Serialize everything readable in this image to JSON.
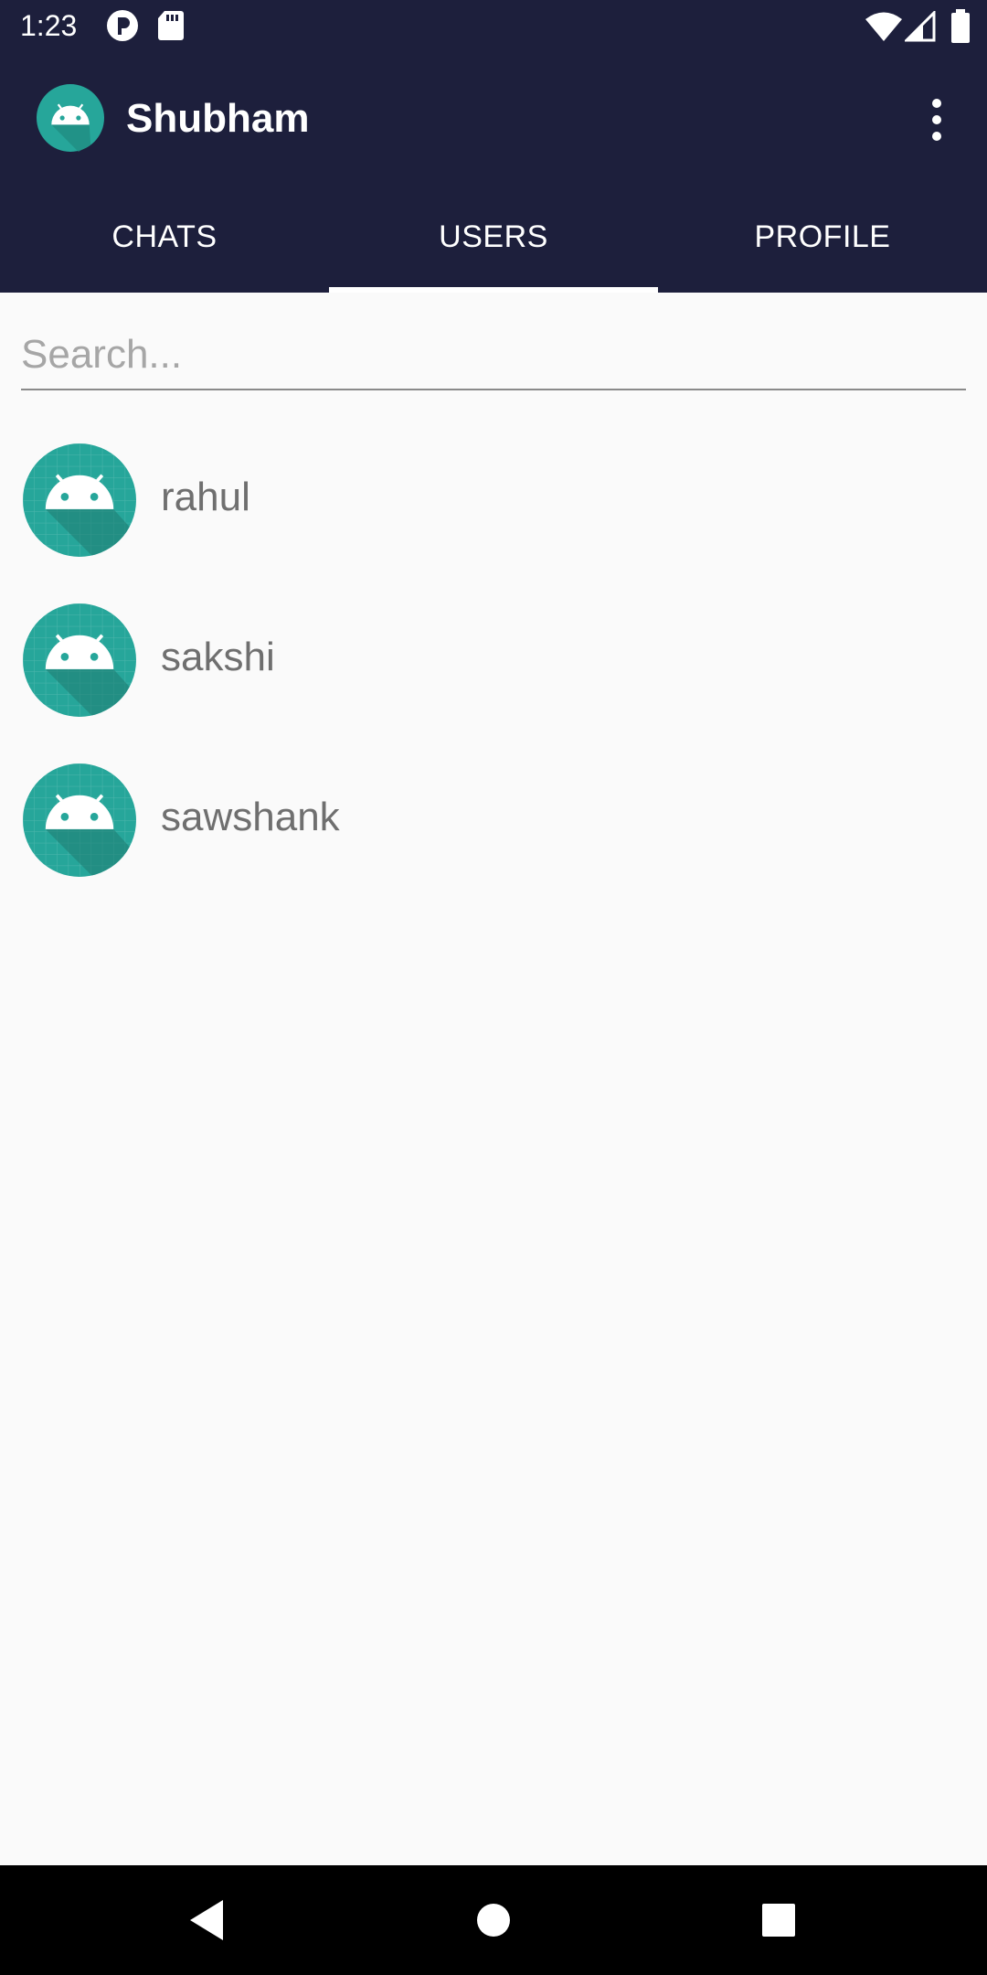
{
  "status_bar": {
    "time": "1:23",
    "icons": [
      "notification-p-icon",
      "sd-card-icon",
      "wifi-icon",
      "signal-icon",
      "battery-icon"
    ]
  },
  "toolbar": {
    "title": "Shubham",
    "menu_icon": "more-vert-icon"
  },
  "tabs": [
    {
      "label": "CHATS",
      "selected": false
    },
    {
      "label": "USERS",
      "selected": true
    },
    {
      "label": "PROFILE",
      "selected": false
    }
  ],
  "search": {
    "placeholder": "Search...",
    "value": ""
  },
  "users": [
    {
      "name": "rahul"
    },
    {
      "name": "sakshi"
    },
    {
      "name": "sawshank"
    }
  ],
  "nav_bar": {
    "buttons": [
      "back-icon",
      "home-icon",
      "recents-icon"
    ]
  },
  "colors": {
    "primary": "#1d1f3c",
    "avatar": "#26a69a",
    "background": "#fafafa"
  }
}
